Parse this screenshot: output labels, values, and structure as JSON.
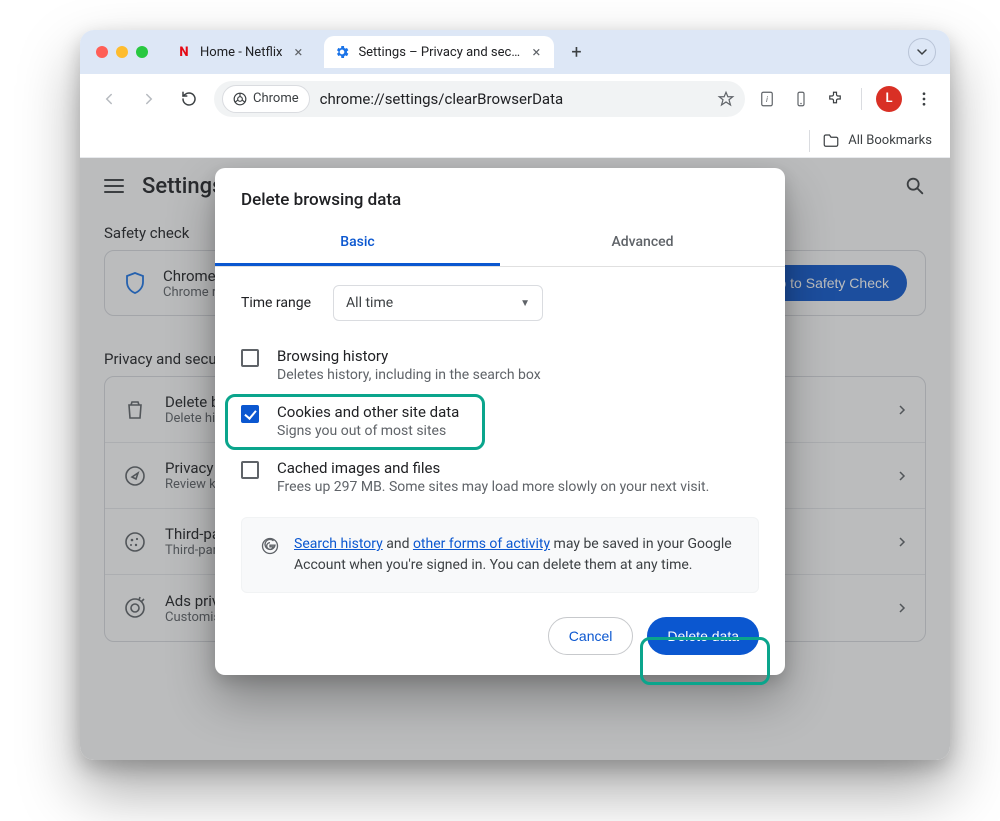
{
  "tabs": {
    "items": [
      {
        "label": "Home - Netflix",
        "favicon": "N",
        "favicon_color": "#e50914"
      },
      {
        "label": "Settings – Privacy and securi",
        "favicon": "gear",
        "favicon_color": "#1a73e8"
      }
    ],
    "active_index": 1
  },
  "omnibox": {
    "chip": "Chrome",
    "url": "chrome://settings/clearBrowserData"
  },
  "toolbar": {
    "avatar_initial": "L",
    "bookmarks_label": "All Bookmarks"
  },
  "page": {
    "title": "Settings",
    "safety_section": "Safety check",
    "safety_line1": "Chrome found some safety recommendations for your review",
    "safety_line2": "Chrome regularly checks to make sure your browser has the safest settings.",
    "safety_button": "Go to Safety Check",
    "privacy_section": "Privacy and security",
    "rows": [
      {
        "icon": "trash",
        "t1": "Delete browsing data",
        "t2": "Delete history, cookies, cache and more"
      },
      {
        "icon": "compass",
        "t1": "Privacy Guide",
        "t2": "Review key privacy and security controls"
      },
      {
        "icon": "cookie",
        "t1": "Third-party cookies",
        "t2": "Third-party cookies are blocked"
      },
      {
        "icon": "ads",
        "t1": "Ads privacy",
        "t2": "Customise the info used by sites to show you ads"
      }
    ]
  },
  "modal": {
    "title": "Delete browsing data",
    "tab_basic": "Basic",
    "tab_advanced": "Advanced",
    "time_label": "Time range",
    "time_value": "All time",
    "items": [
      {
        "checked": false,
        "t1": "Browsing history",
        "t2": "Deletes history, including in the search box"
      },
      {
        "checked": true,
        "t1": "Cookies and other site data",
        "t2": "Signs you out of most sites"
      },
      {
        "checked": false,
        "t1": "Cached images and files",
        "t2": "Frees up 297 MB. Some sites may load more slowly on your next visit."
      }
    ],
    "info": {
      "link1": "Search history",
      "mid1": " and ",
      "link2": "other forms of activity",
      "rest": " may be saved in your Google Account when you're signed in. You can delete them at any time."
    },
    "cancel": "Cancel",
    "confirm": "Delete data"
  }
}
